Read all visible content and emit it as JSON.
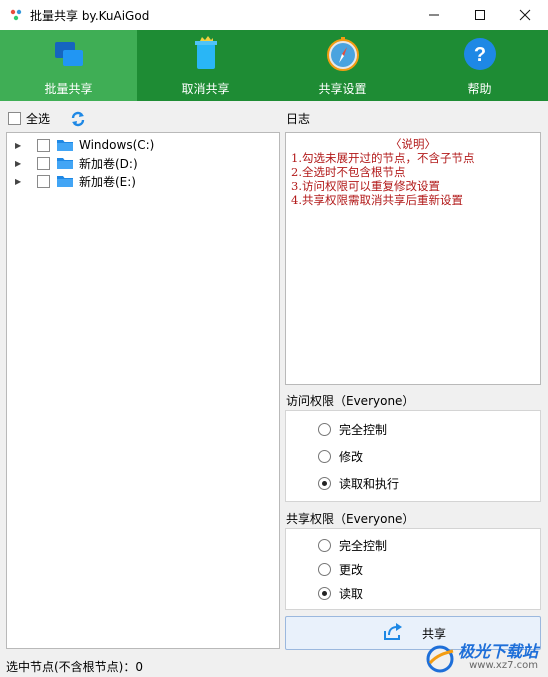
{
  "window": {
    "title": "批量共享 by.KuAiGod",
    "minimize": "—",
    "maximize": "☐",
    "close": "✕"
  },
  "toolbar": [
    {
      "label": "批量共享",
      "icon": "windows-share-icon"
    },
    {
      "label": "取消共享",
      "icon": "trash-can-icon"
    },
    {
      "label": "共享设置",
      "icon": "compass-icon"
    },
    {
      "label": "帮助",
      "icon": "help-icon"
    }
  ],
  "select_all_label": "全选",
  "tree": [
    {
      "label": "Windows(C:)"
    },
    {
      "label": "新加卷(D:)"
    },
    {
      "label": "新加卷(E:)"
    }
  ],
  "log": {
    "title": "日志",
    "heading": "〈说明〉",
    "lines": [
      "1.勾选未展开过的节点，不含子节点",
      "2.全选时不包含根节点",
      "3.访问权限可以重复修改设置",
      "4.共享权限需取消共享后重新设置"
    ]
  },
  "access": {
    "title": "访问权限（Everyone）",
    "options": [
      "完全控制",
      "修改",
      "读取和执行"
    ],
    "selected": 2
  },
  "share_perm": {
    "title": "共享权限（Everyone）",
    "options": [
      "完全控制",
      "更改",
      "读取"
    ],
    "selected": 2
  },
  "share_button": "共享",
  "status": "选中节点(不含根节点)：0",
  "watermark": {
    "text": "极光下载站",
    "url": "www.xz7.com"
  },
  "colors": {
    "toolbar": "#1e8c34",
    "toolbar_active": "#3fae55",
    "log_text": "#b21a1a"
  }
}
